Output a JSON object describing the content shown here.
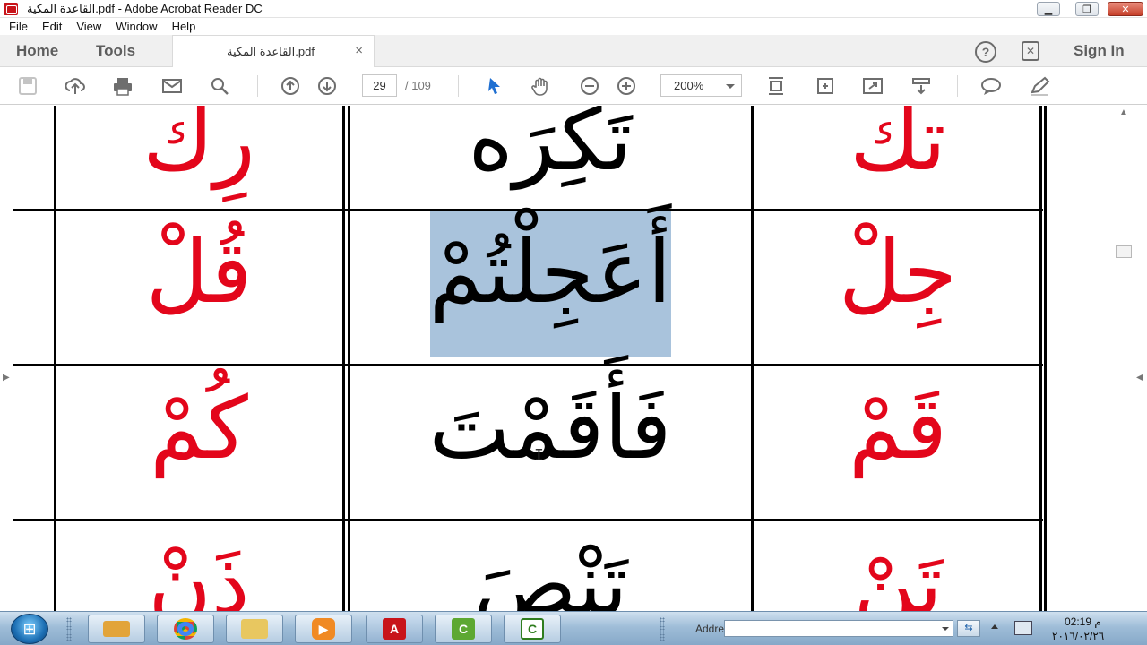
{
  "window": {
    "title": "القاعدة المكية.pdf - Adobe Acrobat Reader DC",
    "controls": {
      "minimize": "▁",
      "restore": "❐",
      "close": "✕"
    }
  },
  "menu": [
    "File",
    "Edit",
    "View",
    "Window",
    "Help"
  ],
  "tabs": {
    "home": "Home",
    "tools": "Tools",
    "document": "القاعدة المكية.pdf",
    "close": "×",
    "sign_in": "Sign In",
    "help_glyph": "?"
  },
  "toolbar": {
    "page_current": "29",
    "page_total": "/ 109",
    "zoom": "200%",
    "icons": [
      "save-icon",
      "upload-icon",
      "print-icon",
      "email-icon",
      "search-icon",
      "page-up-icon",
      "page-down-icon",
      "select-cursor-icon",
      "hand-icon",
      "zoom-out-icon",
      "zoom-in-icon",
      "fit-page-icon",
      "rotate-icon",
      "fullscreen-icon",
      "scroll-mode-icon",
      "comment-icon",
      "highlight-pen-icon"
    ]
  },
  "document": {
    "rows": [
      {
        "cells": [
          {
            "red": "رِك",
            "black": ""
          },
          {
            "red": "",
            "black": "تَكِرَه"
          },
          {
            "red": "تك",
            "black": ""
          }
        ]
      },
      {
        "cells": [
          {
            "red": "قُلْ",
            "black": ""
          },
          {
            "red": "",
            "black": "أَعَجِلْتُمْ"
          },
          {
            "red": "جِلْ",
            "black": ""
          }
        ]
      },
      {
        "cells": [
          {
            "red": "كُمْ",
            "black": ""
          },
          {
            "red": "",
            "black": "فَأَقَمْتَ"
          },
          {
            "red": "قَمْ",
            "black": ""
          }
        ]
      },
      {
        "cells": [
          {
            "red": "ذَنْ",
            "black": ""
          },
          {
            "red": "",
            "black": "تَنْصَ"
          },
          {
            "red": "تَنْ",
            "black": ""
          }
        ]
      }
    ],
    "selected_word": "أَعَجِلْتُمْ"
  },
  "taskbar": {
    "start": "⊞",
    "address_label": "Address",
    "address_value": "",
    "time": "02:19 م",
    "date": "٢٠١٦/٠٢/٢٦",
    "apps": [
      "keyboard-app",
      "chrome-app",
      "explorer-app",
      "media-player-app",
      "acrobat-app",
      "camtasia-recorder-app",
      "camtasia-studio-app"
    ]
  },
  "colors": {
    "red_text": "#e3061b",
    "selection": "#a9c3dc"
  }
}
